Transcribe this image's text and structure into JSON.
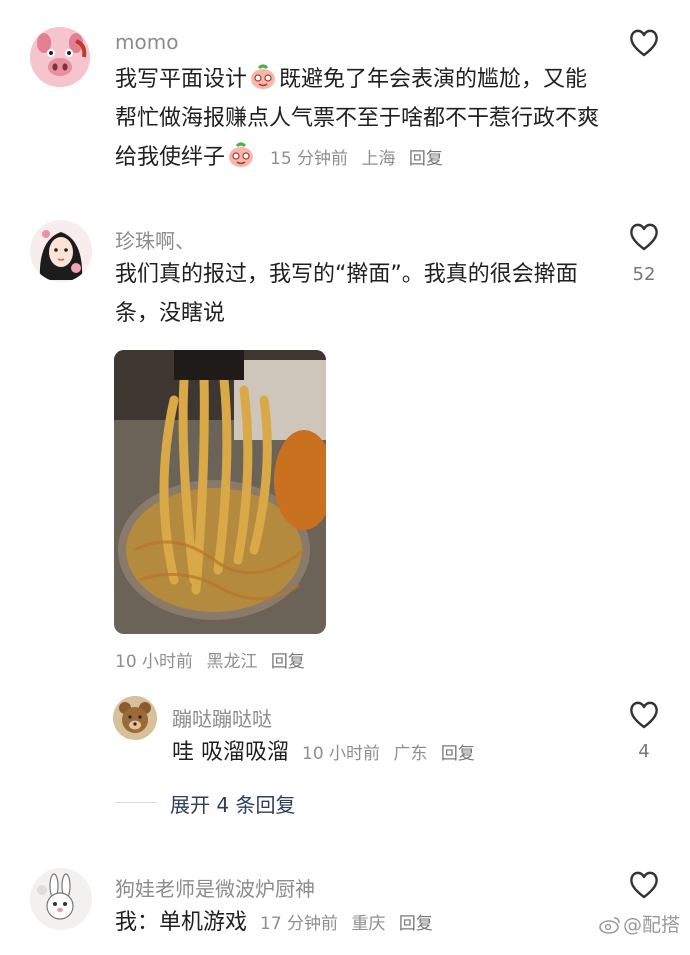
{
  "comments": [
    {
      "username": "momo",
      "text_part1": "我写平面设计",
      "text_part2": "既避免了年会表演的尴尬，又能帮忙做海报赚点人气票不至于啥都不干惹行政不爽给我使绊子",
      "time": "15 分钟前",
      "location": "上海",
      "reply": "回复",
      "avatar_icon": "pig-avatar",
      "emoji_icon": "peach-face-emoji"
    },
    {
      "username": "珍珠啊、",
      "text": "我们真的报过，我写的“擀面”。我真的很会擀面条，没瞎说",
      "time": "10 小时前",
      "location": "黑龙江",
      "reply": "回复",
      "likes": "52",
      "avatar_icon": "girl-avatar",
      "photo_icon": "noodle-photo"
    }
  ],
  "reply": {
    "username": "蹦哒蹦哒哒",
    "text": "哇 吸溜吸溜",
    "time": "10 小时前",
    "location": "广东",
    "reply": "回复",
    "likes": "4",
    "avatar_icon": "bear-avatar"
  },
  "expand": {
    "label": "展开 4 条回复"
  },
  "last_comment": {
    "username": "狗娃老师是微波炉厨神",
    "text": "我：单机游戏",
    "time": "17 分钟前",
    "location": "重庆",
    "reply": "回复",
    "avatar_icon": "rabbit-avatar"
  },
  "watermark": "@配搭",
  "colors": {
    "body_text": "#1f1f1f",
    "username": "#8c8c8c",
    "meta": "#8f8f8f",
    "expand_link": "#2e3d5c",
    "heart_stroke": "#333333"
  }
}
